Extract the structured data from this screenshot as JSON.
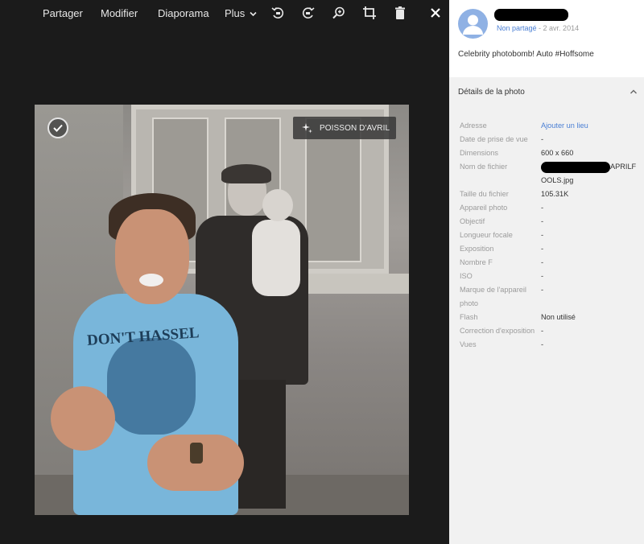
{
  "toolbar": {
    "share_label": "Partager",
    "edit_label": "Modifier",
    "slideshow_label": "Diaporama",
    "more_label": "Plus"
  },
  "icons": {
    "rotate_left": "rotate-left-icon",
    "rotate_right": "rotate-right-icon",
    "zoom": "zoom-icon",
    "crop": "crop-icon",
    "delete": "trash-icon",
    "close": "close-icon"
  },
  "photo": {
    "badge_label": "POISSON D'AVRIL",
    "tshirt_text": "DON'T HASSEL"
  },
  "panel": {
    "visibility": "Non partagé",
    "date_sep": " - ",
    "date": "2 avr. 2014",
    "caption": "Celebrity photobomb! Auto #Hoffsome",
    "details_title": "Détails de la photo",
    "rows": [
      {
        "label": "Adresse",
        "value": "Ajouter un lieu"
      },
      {
        "label": "Date de prise de vue",
        "value": "-"
      },
      {
        "label": "Dimensions",
        "value": "600 x 660"
      },
      {
        "label": "Nom de fichier",
        "value_end": "APRILF",
        "value_line2": "OOLS.jpg"
      },
      {
        "label": "Taille du fichier",
        "value": "105.31K"
      },
      {
        "label": "Appareil photo",
        "value": "-"
      },
      {
        "label": "Objectif",
        "value": "-"
      },
      {
        "label": "Longueur focale",
        "value": "-"
      },
      {
        "label": "Exposition",
        "value": "-"
      },
      {
        "label": "Nombre F",
        "value": "-"
      },
      {
        "label": "ISO",
        "value": "-"
      },
      {
        "label": "Marque de l'appareil photo",
        "value": "-"
      },
      {
        "label": "Flash",
        "value": "Non utilisé"
      },
      {
        "label": "Correction d'exposition",
        "value": "-"
      },
      {
        "label": "Vues",
        "value": "-"
      }
    ]
  },
  "colors": {
    "viewer_bg": "#1b1b1b",
    "link": "#4a7fd4",
    "details_bg": "#f1f1f1"
  }
}
